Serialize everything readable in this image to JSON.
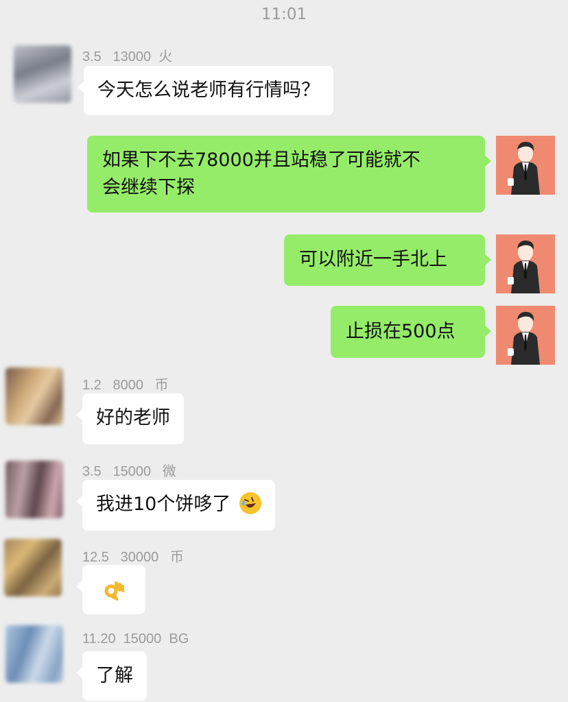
{
  "status_time": "11:01",
  "messages": [
    {
      "sender": "3.5   13000  火",
      "text": "今天怎么说老师有行情吗？"
    },
    {
      "text_line1": "如果下不去78000并且站稳了可能就不",
      "text_line2": "会继续下探"
    },
    {
      "text": "可以附近一手北上"
    },
    {
      "text": "止损在500点"
    },
    {
      "sender": "1.2   8000   币",
      "text": "好的老师"
    },
    {
      "sender": "3.5   15000   微",
      "text": "我进10个饼哆了"
    },
    {
      "sender": "12.5   30000   币",
      "text": ""
    },
    {
      "sender": "11.20  15000  BG",
      "text": "了解"
    }
  ],
  "icons": {
    "laugh_emoji": "rolling-on-floor-laughing-icon",
    "ok_emoji": "ok-hand-icon"
  },
  "colors": {
    "background": "#ededed",
    "outgoing_bubble": "#95ec69",
    "incoming_bubble": "#ffffff",
    "teacher_avatar_bg": "#ef8a70"
  }
}
